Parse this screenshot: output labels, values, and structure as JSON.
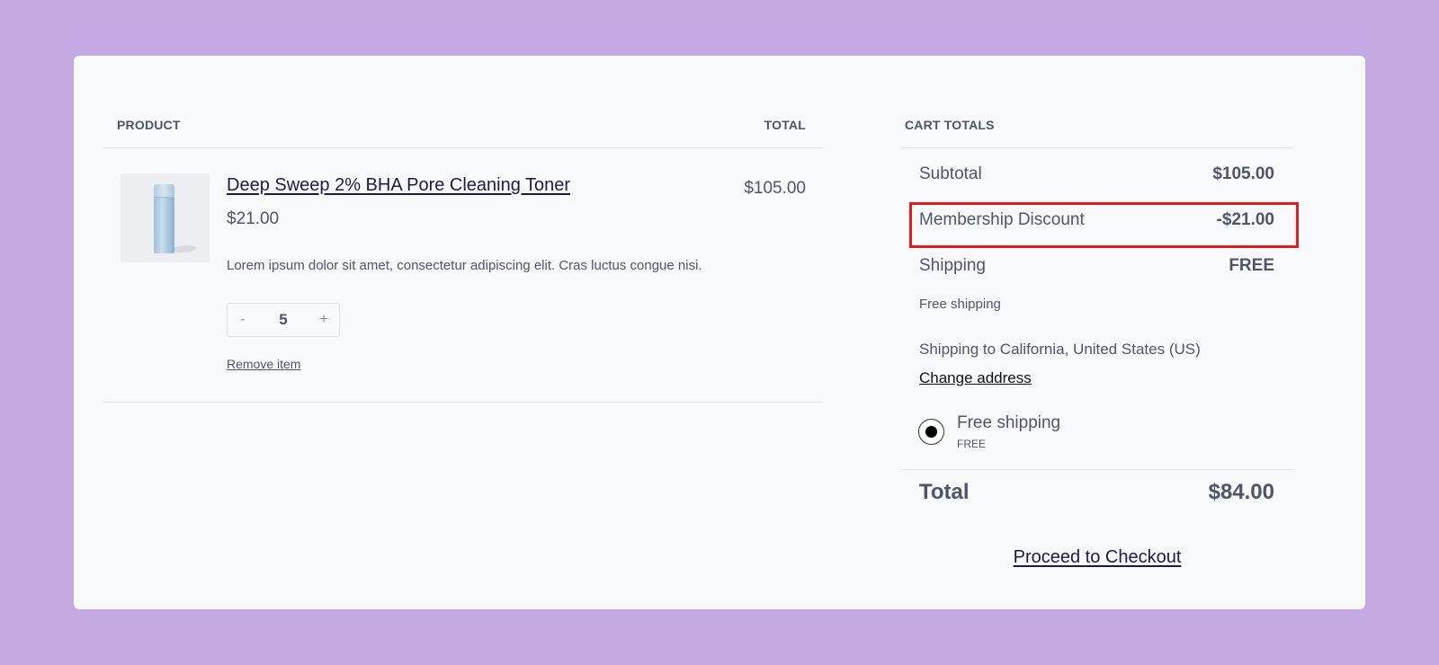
{
  "cart": {
    "header_product": "PRODUCT",
    "header_total": "TOTAL",
    "item": {
      "name": "Deep Sweep 2% BHA Pore Cleaning Toner",
      "price": "$21.00",
      "line_total": "$105.00",
      "description": "Lorem ipsum dolor sit amet, consectetur adipiscing elit. Cras luctus congue nisi.",
      "quantity": "5",
      "qty_minus": "-",
      "qty_plus": "+",
      "remove_label": "Remove item"
    }
  },
  "totals": {
    "title": "CART TOTALS",
    "subtotal_label": "Subtotal",
    "subtotal_value": "$105.00",
    "discount_label": "Membership Discount",
    "discount_value": "-$21.00",
    "shipping_label": "Shipping",
    "shipping_value": "FREE",
    "shipping_note": "Free shipping",
    "shipping_to": "Shipping to California, United States (US)",
    "change_address": "Change address",
    "option_label": "Free shipping",
    "option_sub": "FREE",
    "total_label": "Total",
    "total_value": "$84.00",
    "checkout_label": "Proceed to Checkout"
  },
  "colors": {
    "background": "#c3a8e1",
    "card": "#f8f9fb",
    "highlight": "#e01e1e",
    "link": "#1c1a4a"
  }
}
